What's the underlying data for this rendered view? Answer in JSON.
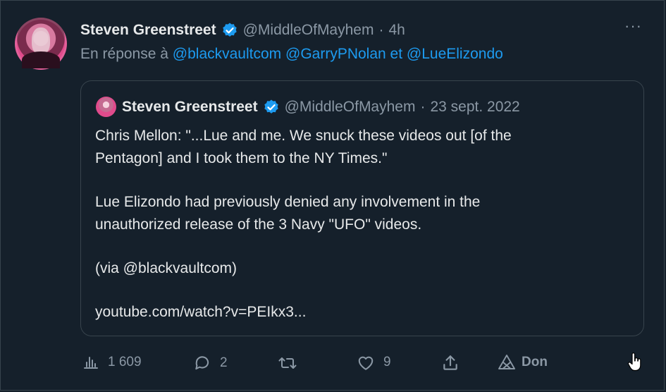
{
  "tweet": {
    "author_name": "Steven Greenstreet",
    "handle": "@MiddleOfMayhem",
    "separator": "·",
    "time": "4h",
    "more_label": "···",
    "reply_prefix": "En réponse à",
    "reply_mentions": [
      "@blackvaultcom",
      "@GarryPNolan",
      "@LueElizondo"
    ],
    "reply_joiner": "et"
  },
  "quoted": {
    "author_name": "Steven Greenstreet",
    "handle": "@MiddleOfMayhem",
    "separator": "·",
    "date": "23 sept. 2022",
    "lines": [
      "Chris Mellon: \"...Lue and me. We snuck these videos out [of the",
      "Pentagon] and I took them to the NY Times.\"",
      "Lue Elizondo had previously denied any involvement in the",
      "unauthorized release of the 3 Navy \"UFO\" videos.",
      "(via @blackvaultcom)",
      "youtube.com/watch?v=PEIkx3..."
    ]
  },
  "actions": {
    "views": "1 609",
    "replies": "2",
    "retweets": "",
    "likes": "9",
    "donate": "Don"
  },
  "colors": {
    "background": "#15202b",
    "accent": "#1d9bf0",
    "muted": "#8b98a5",
    "text": "#e7e9ea"
  },
  "icons": [
    "verified-badge-icon",
    "more-icon",
    "views-icon",
    "reply-icon",
    "retweet-icon",
    "like-icon",
    "share-icon",
    "donate-icon",
    "hand-cursor-icon"
  ]
}
